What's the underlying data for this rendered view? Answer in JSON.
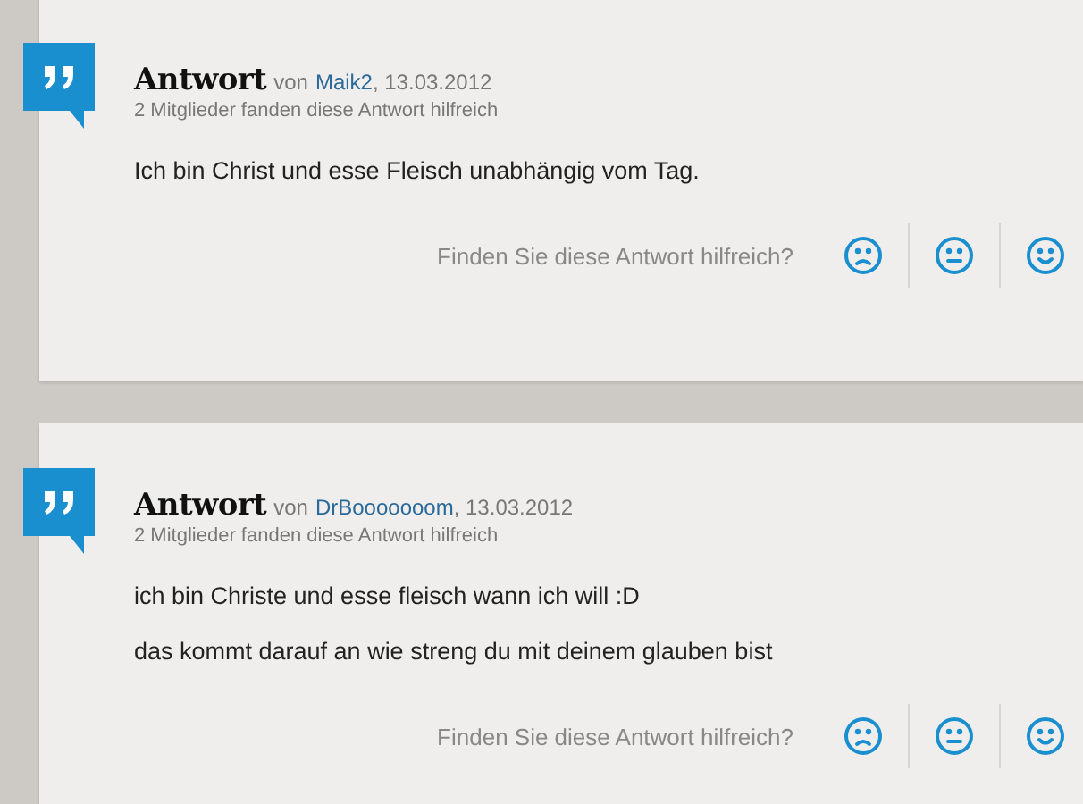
{
  "answers": [
    {
      "title": "Antwort",
      "by": "von",
      "author": "Maik2",
      "date": ", 13.03.2012",
      "helpful_count": "2 Mitglieder fanden diese Antwort hilfreich",
      "paragraphs": [
        "Ich bin Christ und esse Fleisch unabhängig vom Tag."
      ],
      "feedback_prompt": "Finden Sie diese Antwort hilfreich?"
    },
    {
      "title": "Antwort",
      "by": "von",
      "author": "DrBooooooom",
      "date": ", 13.03.2012",
      "helpful_count": "2 Mitglieder fanden diese Antwort hilfreich",
      "paragraphs": [
        "ich bin Christe und esse fleisch wann ich will :D",
        "das kommt darauf an wie streng du mit deinem glauben bist"
      ],
      "feedback_prompt": "Finden Sie diese Antwort hilfreich?"
    }
  ]
}
